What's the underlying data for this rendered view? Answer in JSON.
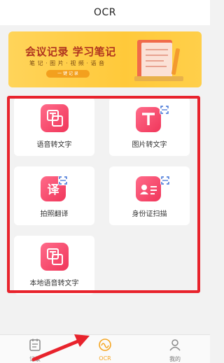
{
  "header": {
    "title": "OCR"
  },
  "banner": {
    "title": "会议记录 学习笔记",
    "subtitle": "笔 记 · 图 片 · 视 频 · 语 音",
    "pill": "一 键 记 录"
  },
  "tiles": [
    {
      "label": "语音转文字"
    },
    {
      "label": "图片转文字"
    },
    {
      "label": "拍照翻译",
      "icon_glyph": "译"
    },
    {
      "label": "身份证扫描"
    },
    {
      "label": "本地语音转文字"
    }
  ],
  "tabs": [
    {
      "label": "记录"
    },
    {
      "label": "OCR"
    },
    {
      "label": "我的"
    }
  ],
  "colors": {
    "accent": "#f5a623",
    "icon_pink": "#f24a6a",
    "annotation_red": "#e8232c",
    "banner_yellow": "#ffc93a"
  }
}
